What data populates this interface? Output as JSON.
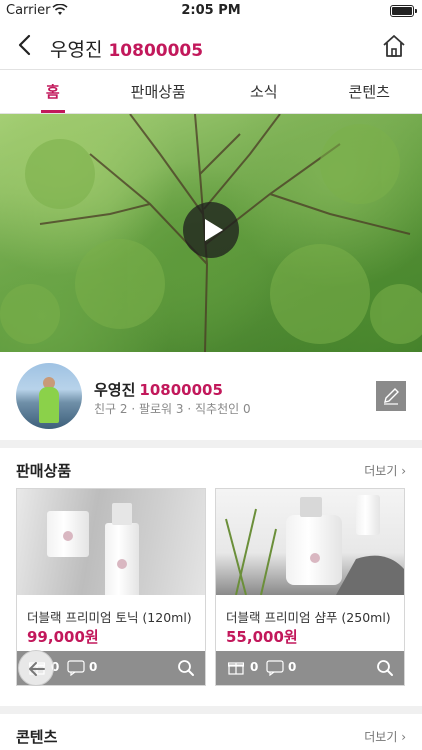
{
  "status_bar": {
    "carrier": "Carrier",
    "time": "2:05 PM"
  },
  "header": {
    "name": "우영진",
    "code": "10800005"
  },
  "tabs": [
    {
      "label": "홈",
      "active": true
    },
    {
      "label": "판매상품",
      "active": false
    },
    {
      "label": "소식",
      "active": false
    },
    {
      "label": "콘텐츠",
      "active": false
    }
  ],
  "profile": {
    "name": "우영진",
    "code": "10800005",
    "stats": "친구 2 · 팔로워 3 · 직추천인 0"
  },
  "products_section": {
    "title": "판매상품",
    "more": "더보기",
    "items": [
      {
        "name": "더블랙 프리미엄 토닉 (120ml)",
        "price": "99,000원",
        "gift_count": "0",
        "comment_count": "0"
      },
      {
        "name": "더블랙 프리미엄 샴푸 (250ml)",
        "price": "55,000원",
        "gift_count": "0",
        "comment_count": "0"
      }
    ]
  },
  "contents_section": {
    "title": "콘텐츠",
    "more": "더보기"
  },
  "colors": {
    "accent": "#c2185b",
    "bar": "#8e8e8e"
  },
  "icons": [
    "back-icon",
    "home-icon",
    "play-icon",
    "pencil-icon",
    "gift-icon",
    "comment-icon",
    "search-icon",
    "chevron-right-icon",
    "arrow-left-icon"
  ]
}
